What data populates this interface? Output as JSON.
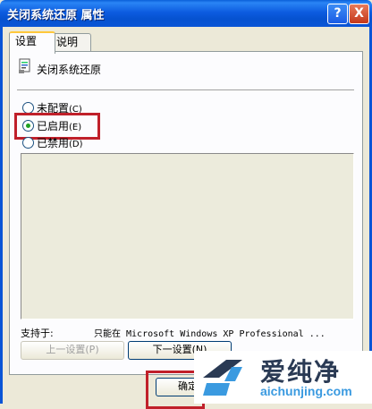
{
  "window": {
    "title": "关闭系统还原 属性",
    "help_btn": "?",
    "close_btn": "X"
  },
  "tabs": [
    {
      "label": "设置",
      "active": true
    },
    {
      "label": "说明",
      "active": false
    }
  ],
  "policy": {
    "name": "关闭系统还原",
    "icon": "policy-setting-icon"
  },
  "options": [
    {
      "label": "未配置",
      "key": "(C)",
      "checked": false
    },
    {
      "label": "已启用",
      "key": "(E)",
      "checked": true
    },
    {
      "label": "已禁用",
      "key": "(D)",
      "checked": false
    }
  ],
  "support": {
    "label": "支持于:",
    "value": "只能在 Microsoft Windows XP Professional ..."
  },
  "buttons": {
    "prev": "上一设置(P)",
    "next": "下一设置(N)",
    "ok": "确定"
  },
  "watermark": {
    "cn": "爱纯净",
    "en": "aichunjing.com"
  },
  "colors": {
    "highlight": "#c0202a",
    "titlebar": "#0a55d6",
    "watermark_blue": "#3a9ae0"
  }
}
